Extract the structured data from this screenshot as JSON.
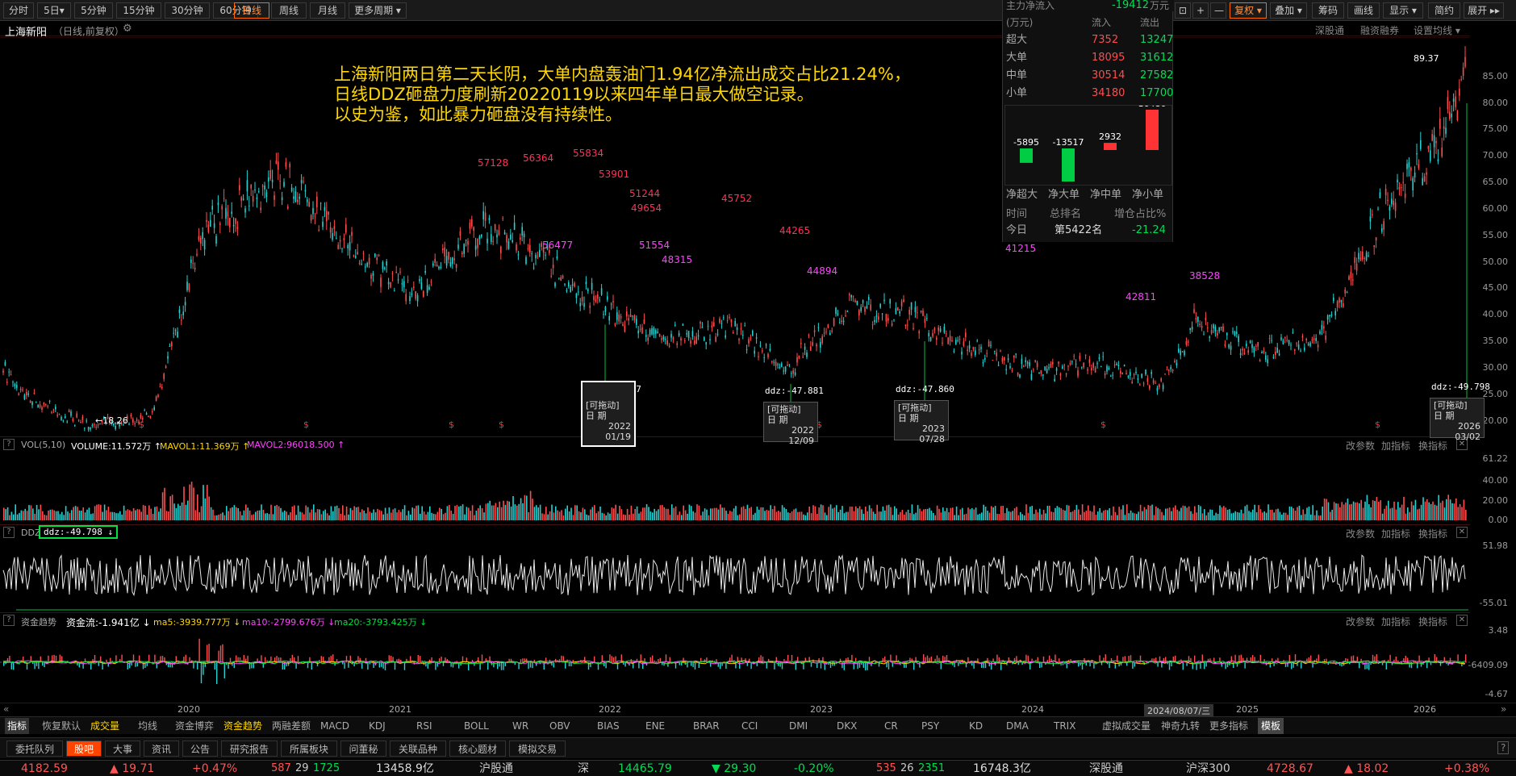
{
  "toolbar": {
    "periods": [
      "分时",
      "5日▾",
      "5分钟",
      "15分钟",
      "30分钟",
      "60分钟",
      "日线",
      "周线",
      "月线",
      "更多周期 ▾"
    ],
    "active": "日线"
  },
  "right_toolbar": {
    "buttons": [
      "⊡",
      "+",
      "—",
      "复权 ▾",
      "叠加 ▾",
      "筹码",
      "画线",
      "显示 ▾",
      "简约",
      "展开 ▸▸"
    ]
  },
  "stock": {
    "name": "上海新阳",
    "sub": "（日线,前复权）"
  },
  "top_strip": {
    "links": [
      "深股通",
      "融资融券",
      "设置均线 ▾"
    ]
  },
  "annotation": [
    "上海新阳两日第二天长阴，大单内盘轰油门1.94亿净流出成交占比21.24%，",
    "日线DDZ砸盘力度刷新20220119以来四年单日最大做空记录。",
    "以史为鉴，如此暴力砸盘没有持续性。"
  ],
  "fund_flow": {
    "title": "主力净流入",
    "value": "-19412",
    "unit": "万元",
    "unit_label": "(万元)",
    "col_in": "流入",
    "col_out": "流出",
    "rows": [
      {
        "label": "超大",
        "in": "7352",
        "out": "13247"
      },
      {
        "label": "大单",
        "in": "18095",
        "out": "31612"
      },
      {
        "label": "中单",
        "in": "30514",
        "out": "27582"
      },
      {
        "label": "小单",
        "in": "34180",
        "out": "17700"
      }
    ],
    "bars": [
      {
        "label": "净超大",
        "value": -5895
      },
      {
        "label": "净大单",
        "value": -13517
      },
      {
        "label": "净中单",
        "value": 2932
      },
      {
        "label": "净小单",
        "value": 16480
      }
    ],
    "rank_hdr": [
      "时间",
      "总排名",
      "增仓占比%"
    ],
    "rank_row": [
      "今日",
      "第5422名",
      "-21.24"
    ],
    "colors": {
      "up": "#ff3333",
      "down": "#00cc44"
    }
  },
  "price_axis": [
    "85.00",
    "80.00",
    "75.00",
    "70.00",
    "65.00",
    "60.00",
    "55.00",
    "50.00",
    "45.00",
    "40.00",
    "35.00",
    "30.00",
    "25.00",
    "20.00"
  ],
  "price_markers": {
    "high": "89.37",
    "low": "←18.26"
  },
  "price_labels": [
    "57128",
    "56364",
    "55834",
    "53901",
    "51244",
    "49654",
    "45752",
    "44265",
    "42811",
    "56477",
    "51554",
    "48315",
    "44894",
    "41215",
    "38528"
  ],
  "drag_boxes": [
    {
      "ddz": "ddz:-53.527",
      "title": "[可拖动]",
      "date_lbl": "日  期",
      "year": "2022",
      "md": "01/19"
    },
    {
      "ddz": "ddz:-47.881",
      "title": "[可拖动]",
      "date_lbl": "日  期",
      "year": "2022",
      "md": "12/09"
    },
    {
      "ddz": "ddz:-47.860",
      "title": "[可拖动]",
      "date_lbl": "日  期",
      "year": "2023",
      "md": "07/28"
    },
    {
      "ddz": "ddz:-49.798",
      "title": "[可拖动]",
      "date_lbl": "日  期",
      "year": "2026",
      "md": "03/02"
    }
  ],
  "vol_panel": {
    "name": "VOL(5,10)",
    "volume": "VOLUME:11.572万 ↑",
    "mavol1": "MAVOL1:11.369万 ↑",
    "mavol2": "MAVOL2:96018.500 ↑",
    "axis": [
      "61.22",
      "40.00",
      "20.00",
      "0.00"
    ]
  },
  "ddz_panel": {
    "name": "DDZ",
    "value": "ddz:-49.798 ↓",
    "axis": [
      "51.98",
      "-55.01"
    ]
  },
  "fund_panel": {
    "name": "资金趋势",
    "flow": "资金流:-1.941亿 ↓",
    "ma5": "ma5:-3939.777万 ↓",
    "ma10": "ma10:-2799.676万 ↓",
    "ma20": "ma20:-3793.425万 ↓",
    "axis": [
      "3.48",
      "-6409.09",
      "-4.67"
    ]
  },
  "panel_links": [
    "改参数",
    "加指标",
    "换指标"
  ],
  "x_axis": [
    "2020",
    "2021",
    "2022",
    "2023",
    "2024",
    "2025",
    "2026"
  ],
  "cursor_date": "2024/08/07/三",
  "indicator_tabs": [
    "指标",
    "恢复默认",
    "成交量",
    "均线",
    "资金博弈",
    "资金趋势",
    "两融差额",
    "MACD",
    "KDJ",
    "RSI",
    "BOLL",
    "WR",
    "OBV",
    "BIAS",
    "ENE",
    "BRAR",
    "CCI",
    "DMI",
    "DKX",
    "CR",
    "PSY",
    "KD",
    "DMA",
    "TRIX",
    "虚拟成交量",
    "神奇九转",
    "更多指标",
    "模板"
  ],
  "info_tabs": [
    "委托队列",
    "股吧",
    "大事",
    "资讯",
    "公告",
    "研究报告",
    "所属板块",
    "问董秘",
    "关联品种",
    "核心题材",
    "模拟交易"
  ],
  "active_info_tab": "股吧",
  "status": {
    "sh_index": "4182.59",
    "sh_chg": "▲ 19.71",
    "sh_pct": "+0.47%",
    "sh_up": "587",
    "sh_flat": "29",
    "sh_down": "1725",
    "sh_amt": "13458.9亿",
    "hgt": "沪股通",
    "sz_label": "深",
    "sz_index": "14465.79",
    "sz_chg": "▼ 29.30",
    "sz_pct": "-0.20%",
    "sz_up": "535",
    "sz_flat": "26",
    "sz_down": "2351",
    "sz_amt": "16748.3亿",
    "sgt": "深股通",
    "hs300": "沪深300",
    "hs300_val": "4728.67",
    "hs300_chg": "▲ 18.02",
    "hs300_pct": "+0.38%"
  }
}
